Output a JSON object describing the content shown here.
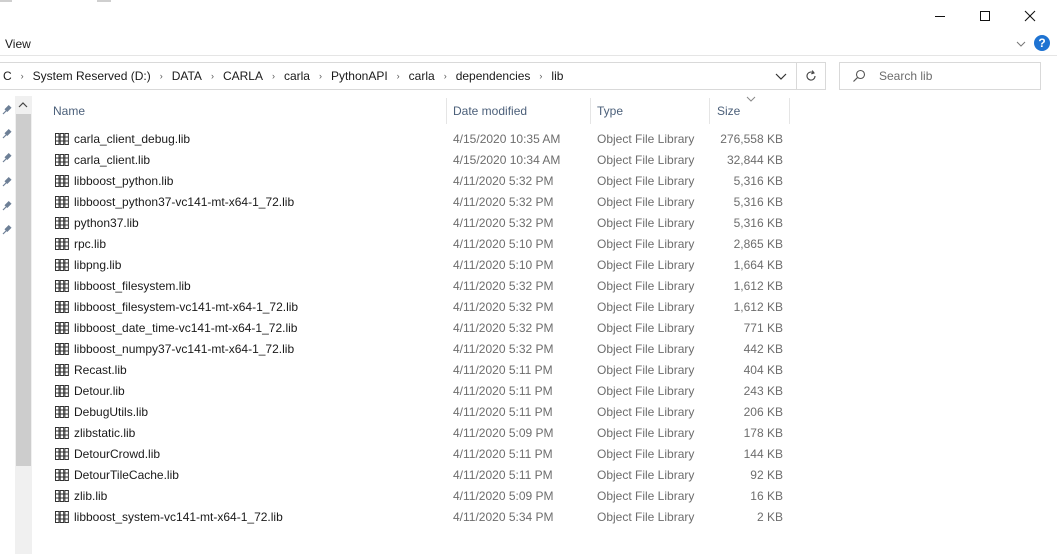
{
  "ribbon": {
    "view_tab": "View"
  },
  "address": {
    "crumbs": [
      "C",
      "System Reserved (D:)",
      "DATA",
      "CARLA",
      "carla",
      "PythonAPI",
      "carla",
      "dependencies",
      "lib"
    ]
  },
  "search": {
    "placeholder": "Search lib"
  },
  "columns": {
    "name": "Name",
    "date": "Date modified",
    "type": "Type",
    "size": "Size"
  },
  "files": [
    {
      "name": "carla_client_debug.lib",
      "date": "4/15/2020 10:35 AM",
      "type": "Object File Library",
      "size": "276,558 KB"
    },
    {
      "name": "carla_client.lib",
      "date": "4/15/2020 10:34 AM",
      "type": "Object File Library",
      "size": "32,844 KB"
    },
    {
      "name": "libboost_python.lib",
      "date": "4/11/2020 5:32 PM",
      "type": "Object File Library",
      "size": "5,316 KB"
    },
    {
      "name": "libboost_python37-vc141-mt-x64-1_72.lib",
      "date": "4/11/2020 5:32 PM",
      "type": "Object File Library",
      "size": "5,316 KB"
    },
    {
      "name": "python37.lib",
      "date": "4/11/2020 5:32 PM",
      "type": "Object File Library",
      "size": "5,316 KB"
    },
    {
      "name": "rpc.lib",
      "date": "4/11/2020 5:10 PM",
      "type": "Object File Library",
      "size": "2,865 KB"
    },
    {
      "name": "libpng.lib",
      "date": "4/11/2020 5:10 PM",
      "type": "Object File Library",
      "size": "1,664 KB"
    },
    {
      "name": "libboost_filesystem.lib",
      "date": "4/11/2020 5:32 PM",
      "type": "Object File Library",
      "size": "1,612 KB"
    },
    {
      "name": "libboost_filesystem-vc141-mt-x64-1_72.lib",
      "date": "4/11/2020 5:32 PM",
      "type": "Object File Library",
      "size": "1,612 KB"
    },
    {
      "name": "libboost_date_time-vc141-mt-x64-1_72.lib",
      "date": "4/11/2020 5:32 PM",
      "type": "Object File Library",
      "size": "771 KB"
    },
    {
      "name": "libboost_numpy37-vc141-mt-x64-1_72.lib",
      "date": "4/11/2020 5:32 PM",
      "type": "Object File Library",
      "size": "442 KB"
    },
    {
      "name": "Recast.lib",
      "date": "4/11/2020 5:11 PM",
      "type": "Object File Library",
      "size": "404 KB"
    },
    {
      "name": "Detour.lib",
      "date": "4/11/2020 5:11 PM",
      "type": "Object File Library",
      "size": "243 KB"
    },
    {
      "name": "DebugUtils.lib",
      "date": "4/11/2020 5:11 PM",
      "type": "Object File Library",
      "size": "206 KB"
    },
    {
      "name": "zlibstatic.lib",
      "date": "4/11/2020 5:09 PM",
      "type": "Object File Library",
      "size": "178 KB"
    },
    {
      "name": "DetourCrowd.lib",
      "date": "4/11/2020 5:11 PM",
      "type": "Object File Library",
      "size": "144 KB"
    },
    {
      "name": "DetourTileCache.lib",
      "date": "4/11/2020 5:11 PM",
      "type": "Object File Library",
      "size": "92 KB"
    },
    {
      "name": "zlib.lib",
      "date": "4/11/2020 5:09 PM",
      "type": "Object File Library",
      "size": "16 KB"
    },
    {
      "name": "libboost_system-vc141-mt-x64-1_72.lib",
      "date": "4/11/2020 5:34 PM",
      "type": "Object File Library",
      "size": "2 KB"
    }
  ],
  "icons": {
    "minimize": "minimize-icon",
    "maximize": "maximize-icon",
    "close": "close-icon",
    "help": "help-icon",
    "refresh": "refresh-icon",
    "search": "search-icon",
    "file": "library-file-icon",
    "pin": "pin-icon"
  },
  "colors": {
    "accent": "#1e73d2",
    "header_text": "#4c607a",
    "muted_text": "#6d6d6d"
  }
}
